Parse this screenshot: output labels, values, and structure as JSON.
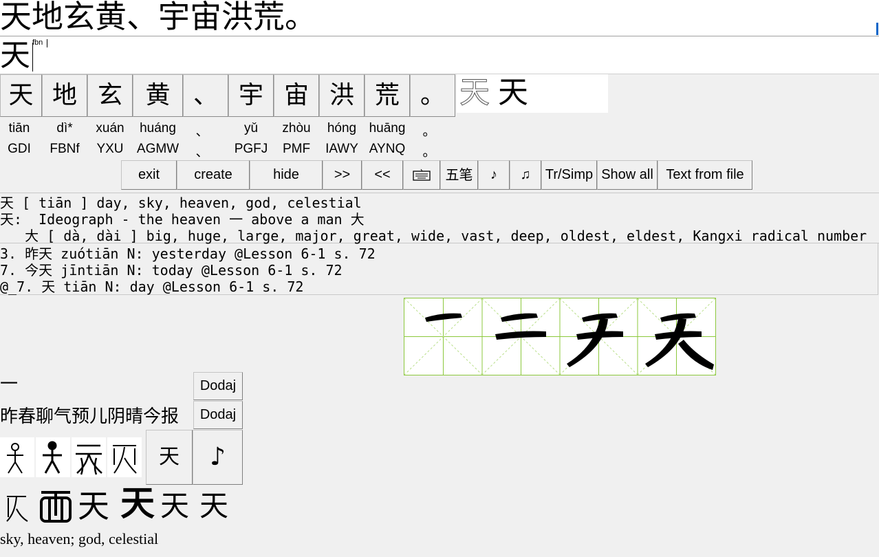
{
  "title_line": "天地玄黄、宇宙洪荒。",
  "input": {
    "char": "天",
    "code": "fbn"
  },
  "chars": [
    {
      "h": "天",
      "py": "tiān",
      "code": "GDI"
    },
    {
      "h": "地",
      "py": "dì*",
      "code": "FBNf"
    },
    {
      "h": "玄",
      "py": "xuán",
      "code": "YXU"
    },
    {
      "h": "黄",
      "py": "huáng",
      "code": "AGMW"
    },
    {
      "h": "、",
      "py": "、",
      "code": "、"
    },
    {
      "h": "宇",
      "py": "yǔ",
      "code": "PGFJ"
    },
    {
      "h": "宙",
      "py": "zhòu",
      "code": "PMF"
    },
    {
      "h": "洪",
      "py": "hóng",
      "code": "IAWY"
    },
    {
      "h": "荒",
      "py": "huāng",
      "code": "AYNQ"
    },
    {
      "h": "。",
      "py": "。",
      "code": "。"
    }
  ],
  "stroke_preview": {
    "a": "天",
    "b": "天"
  },
  "toolbar": {
    "exit": "exit",
    "create": "create",
    "hide": "hide",
    "next": ">>",
    "prev": "<<",
    "keyboard_icon": "keyboard-icon",
    "wubi": "五笔",
    "note1": "♪",
    "note2": "♫",
    "trsimp": "Tr/Simp",
    "showall": "Show all",
    "textfromfile": "Text from file"
  },
  "dict": {
    "line1": "天 [ tiān ] day, sky, heaven, god, celestial",
    "line2": "天:  Ideograph - the heaven 一 above a man 大",
    "line3": "   大 [ dà, dài ] big, huge, large, major, great, wide, vast, deep, oldest, eldest, Kangxi radical number"
  },
  "lessons": {
    "line1": "3. 昨天 zuótiān N: yesterday @Lesson 6-1 s. 72",
    "line2": "7. 今天 jīntiān N: today @Lesson 6-1 s. 72",
    "line3": "@_7. 天 tiān N: day @Lesson 6-1 s. 72"
  },
  "radical_label": "一",
  "related_label": "昨春聊气预儿阴晴今报",
  "dodaj": "Dodaj",
  "seal_char": "天",
  "play_icon": "♪",
  "fontvars": [
    "天",
    "天",
    "天",
    "天"
  ],
  "meaning": "sky, heaven; god, celestial",
  "colors": {
    "grid": "#8cc83c",
    "accent": "#0a64c8"
  }
}
